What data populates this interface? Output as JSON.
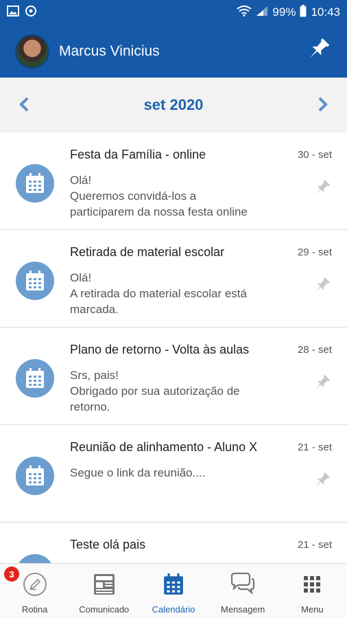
{
  "status_bar": {
    "battery": "99%",
    "time": "10:43"
  },
  "header": {
    "user_name": "Marcus Vinicius"
  },
  "calendar": {
    "month_label": "set 2020"
  },
  "events": [
    {
      "title": "Festa da Família - online",
      "date": "30 - set",
      "lines": [
        "Olá!",
        "Queremos convidá-los a",
        "participarem da nossa festa online"
      ]
    },
    {
      "title": "Retirada de material escolar",
      "date": "29 - set",
      "lines": [
        "Olá!",
        "A retirada do material escolar está",
        "marcada."
      ]
    },
    {
      "title": "Plano de retorno - Volta às aulas",
      "date": "28 - set",
      "lines": [
        "Srs, pais!",
        "Obrigado por sua autorização de",
        "retorno."
      ]
    },
    {
      "title": "Reunião de alinhamento - Aluno X",
      "date": "21 - set",
      "lines": [
        "Segue o link da reunião....",
        "",
        ""
      ]
    },
    {
      "title": "Teste olá pais",
      "date": "21 - set",
      "lines": [
        "",
        "",
        ""
      ]
    }
  ],
  "bottom_nav": {
    "badge_count": "3",
    "items": [
      {
        "label": "Rotina"
      },
      {
        "label": "Comunicado"
      },
      {
        "label": "Calendário"
      },
      {
        "label": "Mensagem"
      },
      {
        "label": "Menu"
      }
    ]
  },
  "colors": {
    "primary": "#1559a8",
    "accent": "#1d64b2",
    "icon_circle": "#6b9ecf",
    "badge": "#e0261f"
  }
}
